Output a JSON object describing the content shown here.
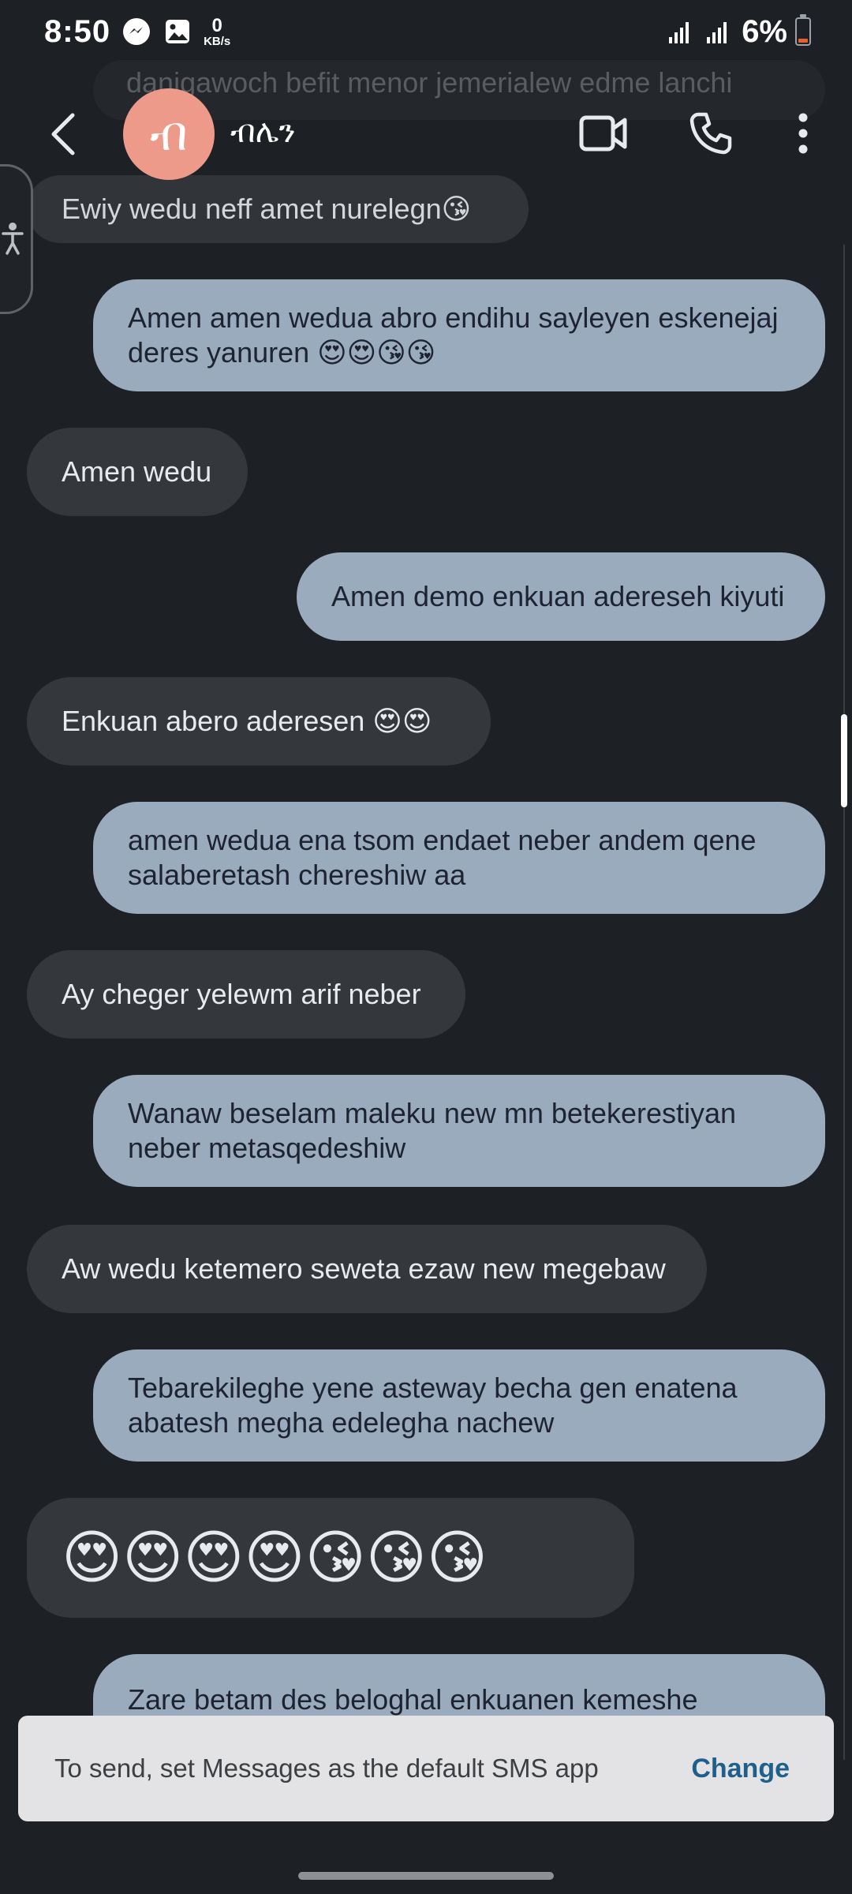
{
  "status_bar": {
    "time": "8:50",
    "net_speed_value": "0",
    "net_speed_unit": "KB/s",
    "battery_percent": "6%",
    "icons": [
      "messenger-icon",
      "gallery-icon",
      "signal-icon",
      "signal-icon",
      "battery-icon"
    ]
  },
  "header": {
    "avatar_initial": "ብ",
    "contact_name": "ብሌን",
    "icons": [
      "back-arrow-icon",
      "video-call-icon",
      "phone-icon",
      "more-vert-icon"
    ]
  },
  "ghost_texts": {
    "top": "danigawoch befit menor jemerialew edme lanchi",
    "partial": "Ewiy wedu neff amet nurelegn😘"
  },
  "messages": [
    {
      "dir": "out",
      "text": "Amen amen wedua abro endihu sayleyen eskenejaj\nderes yanuren 😍😍😘😘"
    },
    {
      "dir": "in",
      "text": "Amen wedu"
    },
    {
      "dir": "out",
      "text": "Amen demo enkuan adereseh kiyuti"
    },
    {
      "dir": "in",
      "text": "Enkuan abero aderesen  😍😍"
    },
    {
      "dir": "out",
      "text": "amen wedua ena tsom endaet neber andem qene\nsalaberetash chereshiw aa"
    },
    {
      "dir": "in",
      "text": "Ay cheger yelewm arif neber"
    },
    {
      "dir": "out",
      "text": "Wanaw beselam maleku new mn betekerestiyan\nneber metasqedeshiw"
    },
    {
      "dir": "in",
      "text": "Aw wedu ketemero seweta ezaw new megebaw"
    },
    {
      "dir": "out",
      "text": "Tebarekileghe yene asteway becha gen enatena\nabatesh megha edelegha nachew"
    },
    {
      "dir": "in",
      "text": "😍😍😍😍😘😘😘"
    },
    {
      "dir": "out",
      "text": "Zare betam des beloghal enkuanen kemeshe"
    }
  ],
  "snackbar": {
    "text": "To send, set Messages as the default SMS app",
    "action": "Change"
  },
  "colors": {
    "background": "#1d2024",
    "incoming_bubble": "#34373c",
    "outgoing_bubble": "#9aabbe",
    "avatar": "#ee9a8a",
    "snackbar": "#e3e3e5",
    "action": "#1f5f8b",
    "battery_low": "#e8612c"
  }
}
